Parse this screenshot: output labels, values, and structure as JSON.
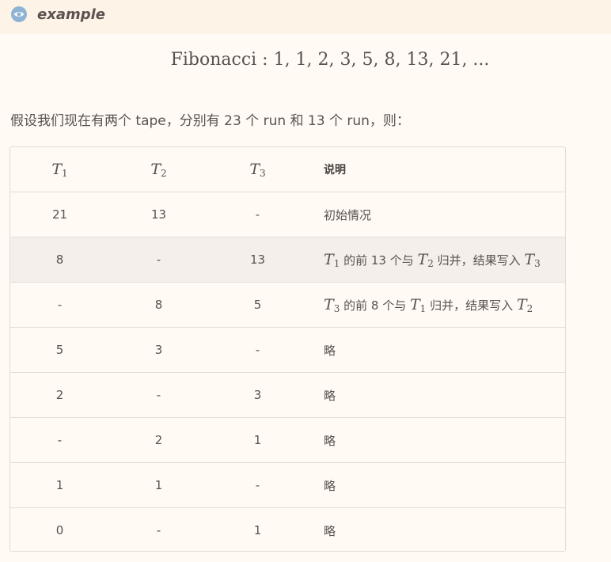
{
  "header": {
    "title": "example",
    "icon": "eye-icon"
  },
  "formula": "Fibonacci : 1, 1, 2, 3, 5, 8, 13, 21, ...",
  "intro": "假设我们现在有两个 tape，分别有 23 个 run 和 13 个 run，则：",
  "table": {
    "headers": [
      {
        "var": "T",
        "sub": "1"
      },
      {
        "var": "T",
        "sub": "2"
      },
      {
        "var": "T",
        "sub": "3"
      },
      {
        "text": "说明"
      }
    ],
    "rows": [
      {
        "t1": "21",
        "t2": "13",
        "t3": "-",
        "desc": "初始情况"
      },
      {
        "t1": "8",
        "t2": "-",
        "t3": "13",
        "desc_a_var": "T",
        "desc_a_sub": "1",
        "desc_b": "的前 13 个与",
        "desc_c_var": "T",
        "desc_c_sub": "2",
        "desc_d": "归并，结果写入",
        "desc_e_var": "T",
        "desc_e_sub": "3"
      },
      {
        "t1": "-",
        "t2": "8",
        "t3": "5",
        "desc_a_var": "T",
        "desc_a_sub": "3",
        "desc_b": "的前 8 个与",
        "desc_c_var": "T",
        "desc_c_sub": "1",
        "desc_d": "归并，结果写入",
        "desc_e_var": "T",
        "desc_e_sub": "2"
      },
      {
        "t1": "5",
        "t2": "3",
        "t3": "-",
        "desc": "略"
      },
      {
        "t1": "2",
        "t2": "-",
        "t3": "3",
        "desc": "略"
      },
      {
        "t1": "-",
        "t2": "2",
        "t3": "1",
        "desc": "略"
      },
      {
        "t1": "1",
        "t2": "1",
        "t3": "-",
        "desc": "略"
      },
      {
        "t1": "0",
        "t2": "-",
        "t3": "1",
        "desc": "略"
      }
    ]
  },
  "colors": {
    "header_bg": "#fdf3e7",
    "page_bg": "#fffaf4",
    "highlight_row": "#f4efea",
    "icon": "#8fb4d3"
  }
}
